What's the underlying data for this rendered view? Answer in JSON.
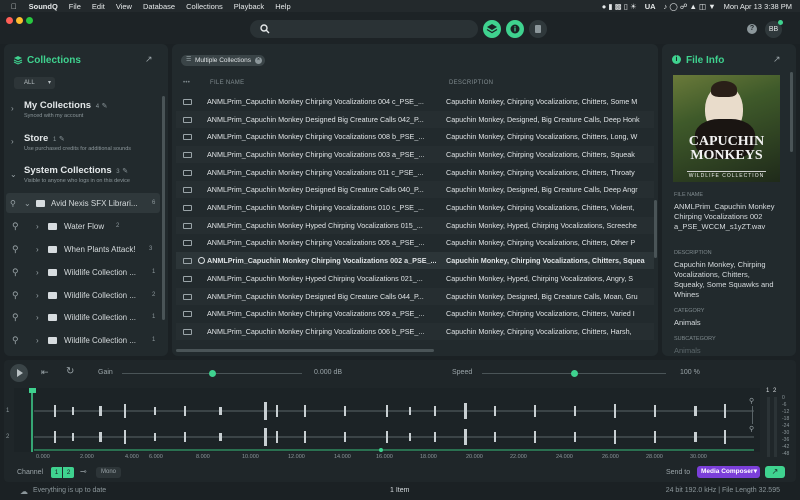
{
  "menubar": {
    "app": "SoundQ",
    "items": [
      "File",
      "Edit",
      "View",
      "Database",
      "Collections",
      "Playback",
      "Help"
    ],
    "keyboard": "UA",
    "clock": "Mon Apr 13  3:38 PM"
  },
  "topbar": {
    "search_placeholder": "",
    "avatar": "BB",
    "accent": "#3fd28f"
  },
  "collections": {
    "title": "Collections",
    "filter": "ALL",
    "my": {
      "label": "My Collections",
      "count": "4",
      "sub": "Synced with my account"
    },
    "store": {
      "label": "Store",
      "count": "1",
      "sub": "Use purchased credits for additional sounds"
    },
    "system": {
      "label": "System Collections",
      "count": "3",
      "sub": "Visible to anyone who logs in on this device"
    },
    "tree": [
      {
        "label": "Avid Nexis SFX Librari...",
        "count": "6"
      },
      {
        "label": "Water Flow",
        "count": "2"
      },
      {
        "label": "When Plants Attack!",
        "count": "3"
      },
      {
        "label": "Wildlife Collection ...",
        "count": "1"
      },
      {
        "label": "Wildlife Collection ...",
        "count": "2"
      },
      {
        "label": "Wildlife Collection ...",
        "count": "1"
      },
      {
        "label": "Wildlife Collection ...",
        "count": "1"
      }
    ]
  },
  "results": {
    "chip": "Multiple Collections",
    "col_file": "FILE NAME",
    "col_desc": "DESCRIPTION",
    "rows": [
      {
        "file": "ANMLPrim_Capuchin Monkey Chirping Vocalizations 004 c_PSE_...",
        "desc": "Capuchin Monkey, Chirping Vocalizations, Chitters, Some M"
      },
      {
        "file": "ANMLPrim_Capuchin Monkey Designed Big Creature Calls 042_P...",
        "desc": "Capuchin Monkey, Designed, Big Creature Calls, Deep Honk"
      },
      {
        "file": "ANMLPrim_Capuchin Monkey Chirping Vocalizations 008 b_PSE_...",
        "desc": "Capuchin Monkey, Chirping Vocalizations, Chitters, Long, W"
      },
      {
        "file": "ANMLPrim_Capuchin Monkey Chirping Vocalizations 003 a_PSE_...",
        "desc": "Capuchin Monkey, Chirping Vocalizations, Chitters, Squeak"
      },
      {
        "file": "ANMLPrim_Capuchin Monkey Chirping Vocalizations 011 c_PSE_...",
        "desc": "Capuchin Monkey, Chirping Vocalizations, Chitters, Throaty"
      },
      {
        "file": "ANMLPrim_Capuchin Monkey Designed Big Creature Calls 040_P...",
        "desc": "Capuchin Monkey, Designed, Big Creature Calls, Deep Angr"
      },
      {
        "file": "ANMLPrim_Capuchin Monkey Chirping Vocalizations 010 c_PSE_...",
        "desc": "Capuchin Monkey, Chirping Vocalizations, Chitters, Violent,"
      },
      {
        "file": "ANMLPrim_Capuchin Monkey Hyped Chirping Vocalizations 015_...",
        "desc": "Capuchin Monkey, Hyped, Chirping Vocalizations, Screeche"
      },
      {
        "file": "ANMLPrim_Capuchin Monkey Chirping Vocalizations 005 a_PSE_...",
        "desc": "Capuchin Monkey, Chirping Vocalizations, Chitters, Other P"
      },
      {
        "file": "ANMLPrim_Capuchin Monkey Chirping Vocalizations 002 a_PSE_...",
        "desc": "Capuchin Monkey, Chirping Vocalizations, Chitters, Squea"
      },
      {
        "file": "ANMLPrim_Capuchin Monkey Hyped Chirping Vocalizations 021_...",
        "desc": "Capuchin Monkey, Hyped, Chirping Vocalizations, Angry, S"
      },
      {
        "file": "ANMLPrim_Capuchin Monkey Designed Big Creature Calls 044_P...",
        "desc": "Capuchin Monkey, Designed, Big Creature Calls, Moan, Gru"
      },
      {
        "file": "ANMLPrim_Capuchin Monkey Chirping Vocalizations 009 a_PSE_...",
        "desc": "Capuchin Monkey, Chirping Vocalizations, Chitters, Varied I"
      },
      {
        "file": "ANMLPrim_Capuchin Monkey Chirping Vocalizations 006 b_PSE_...",
        "desc": "Capuchin Monkey, Chirping Vocalizations, Chitters, Harsh,"
      }
    ]
  },
  "fileinfo": {
    "title": "File Info",
    "art_title": "CAPUCHIN MONKEYS",
    "art_sub": "WILDLIFE COLLECTION",
    "filename_label": "FILE NAME",
    "filename": "ANMLPrim_Capuchin Monkey Chirping Vocalizations 002 a_PSE_WCCM_s1yZT.wav",
    "description_label": "DESCRIPTION",
    "description": "Capuchin Monkey, Chirping Vocalizations, Chitters, Squeaky, Some Squawks and Whines",
    "category_label": "CATEGORY",
    "category": "Animals",
    "subcategory_label": "SUBCATEGORY",
    "subcategory": "Animals"
  },
  "player": {
    "gain_label": "Gain",
    "gain_value": "0.000 dB",
    "gain_level": 0.5,
    "speed_label": "Speed",
    "speed_value": "100 %",
    "speed_level": 0.5,
    "ticks": [
      "0.000",
      "2.000",
      "4.000",
      "6.000",
      "8.000",
      "10.000",
      "12.000",
      "14.000",
      "16.000",
      "18.000",
      "20.000",
      "22.000",
      "24.000",
      "26.000",
      "28.000",
      "30.000"
    ],
    "channel_label": "Channel",
    "ch1": "1",
    "ch2": "2",
    "mono": "Mono",
    "send_label": "Send to",
    "send_target": "Media Composer",
    "meter_labels": [
      "1",
      "2"
    ],
    "db_scale": [
      "0",
      "-6",
      "-12",
      "-18",
      "-24",
      "-30",
      "-36",
      "-42",
      "-48"
    ]
  },
  "status": {
    "left": "Everything is up to date",
    "center": "1 Item",
    "right": "24 bit 192.0 kHz   |   File Length 32.595"
  }
}
